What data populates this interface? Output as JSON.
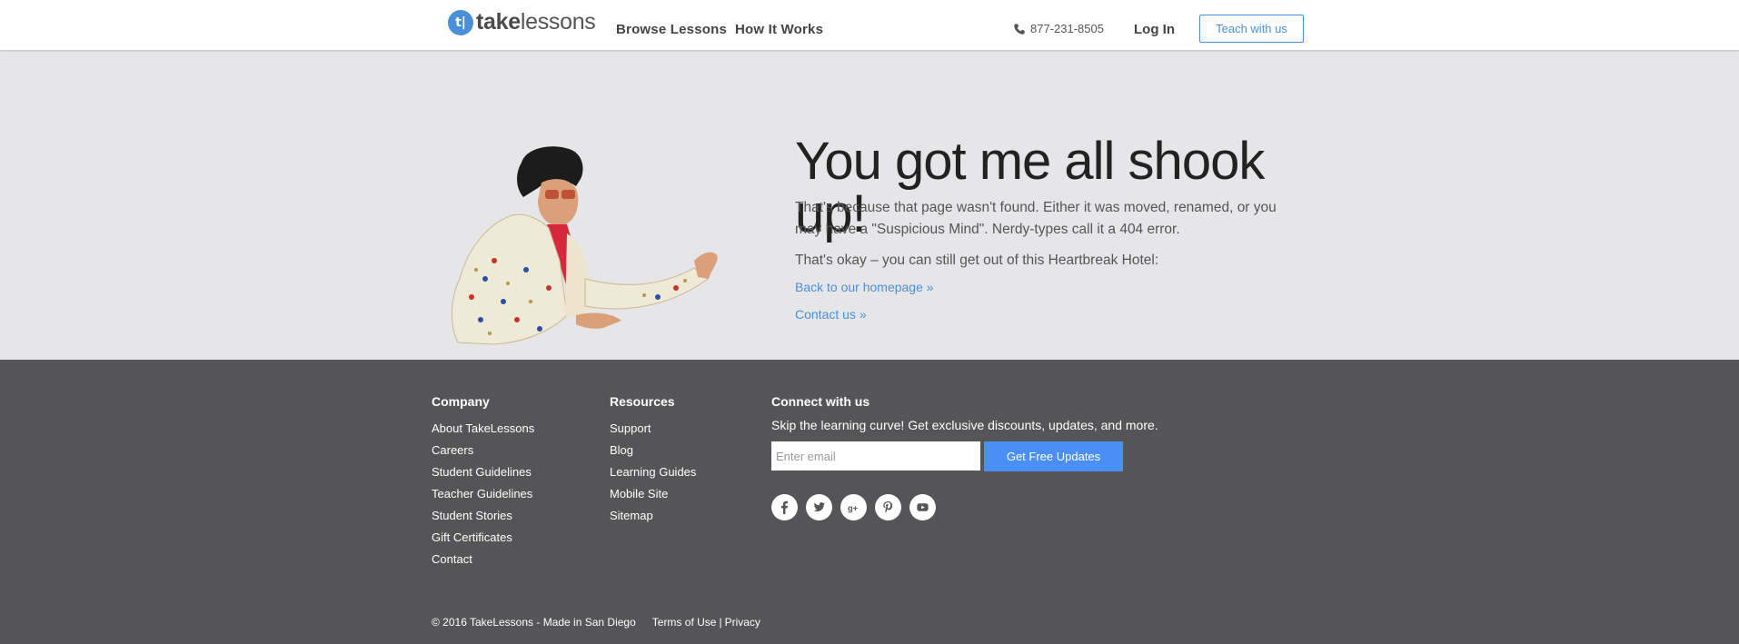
{
  "header": {
    "logo_mark": "t|",
    "logo_bold": "take",
    "logo_light": "lessons",
    "nav": [
      "Browse Lessons",
      "How It Works"
    ],
    "phone": "877-231-8505",
    "login": "Log In",
    "teach": "Teach with us"
  },
  "hero": {
    "headline": "You got me all shook up!",
    "para1": "That's because that page wasn't found. Either it was moved, renamed, or you may have a \"Suspicious Mind\". Nerdy-types call it a 404 error.",
    "para2": "That's okay – you can still get out of this Heartbreak Hotel:",
    "link_home": "Back to our homepage »",
    "link_contact": "Contact us »"
  },
  "footer": {
    "company": {
      "title": "Company",
      "items": [
        "About TakeLessons",
        "Careers",
        "Student Guidelines",
        "Teacher Guidelines",
        "Student Stories",
        "Gift Certificates",
        "Contact"
      ]
    },
    "resources": {
      "title": "Resources",
      "items": [
        "Support",
        "Blog",
        "Learning Guides",
        "Mobile Site",
        "Sitemap"
      ]
    },
    "connect": {
      "title": "Connect with us",
      "text": "Skip the learning curve! Get exclusive discounts, updates, and more.",
      "email_placeholder": "Enter email",
      "button": "Get Free Updates",
      "socials": [
        "facebook-icon",
        "twitter-icon",
        "google-plus-icon",
        "pinterest-icon",
        "youtube-icon"
      ]
    },
    "copyright": "© 2016 TakeLessons - Made in San Diego",
    "terms": "Terms of Use",
    "privacy": "Privacy"
  },
  "colors": {
    "accent": "#4a90d9",
    "footer_bg": "#555557",
    "hero_bg": "#e6e6e9",
    "button_blue": "#4a8ff5"
  }
}
